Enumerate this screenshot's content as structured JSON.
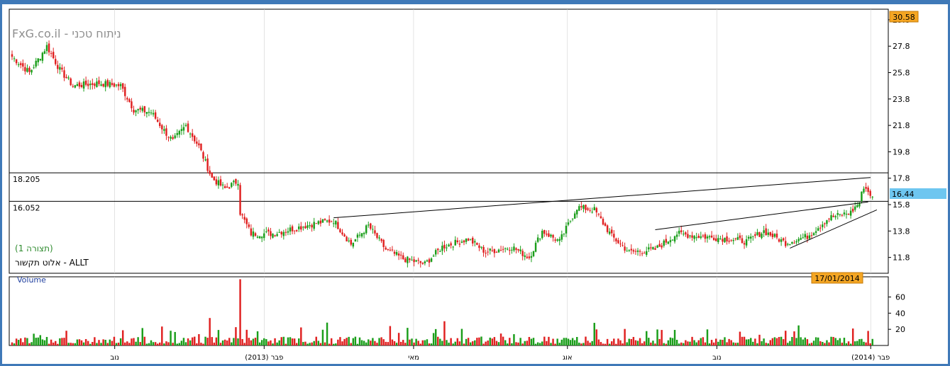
{
  "chart_data": {
    "type": "candlestick",
    "watermark": "FxG.co.il - ניתוח טכני",
    "symbol_label": "אלוט תקשור - ALLT",
    "study_label": "(תצורה 1)",
    "volume_label": "Volume",
    "date_badge": "17/01/2014",
    "price_axis": {
      "ticks": [
        11.8,
        13.8,
        15.8,
        17.8,
        19.8,
        21.8,
        23.8,
        25.8,
        27.8,
        29.8
      ],
      "ylim": [
        10.6,
        30.6
      ],
      "top_badge": "30.58"
    },
    "last_price": "16.44",
    "levels": [
      {
        "label": "18.205",
        "value": 18.205
      },
      {
        "label": "16.052",
        "value": 16.052
      }
    ],
    "volume_axis": {
      "ticks": [
        20,
        40,
        60
      ],
      "ylim": [
        0,
        85
      ]
    },
    "x_labels": [
      "נוב",
      "(2013) פבר",
      "מאי",
      "אוג",
      "נוב",
      "(2014) פבר"
    ],
    "anchors": [
      {
        "i": 0,
        "v": 27.0
      },
      {
        "i": 8,
        "v": 25.8
      },
      {
        "i": 16,
        "v": 27.8
      },
      {
        "i": 22,
        "v": 26.0
      },
      {
        "i": 28,
        "v": 24.8
      },
      {
        "i": 40,
        "v": 25.0
      },
      {
        "i": 50,
        "v": 24.8
      },
      {
        "i": 56,
        "v": 23.0
      },
      {
        "i": 64,
        "v": 22.8
      },
      {
        "i": 70,
        "v": 21.4
      },
      {
        "i": 74,
        "v": 20.6
      },
      {
        "i": 80,
        "v": 21.8
      },
      {
        "i": 86,
        "v": 20.2
      },
      {
        "i": 92,
        "v": 17.8
      },
      {
        "i": 98,
        "v": 17.0
      },
      {
        "i": 104,
        "v": 17.6
      },
      {
        "i": 105,
        "v": 15.2
      },
      {
        "i": 110,
        "v": 13.6
      },
      {
        "i": 120,
        "v": 13.6
      },
      {
        "i": 130,
        "v": 14.0
      },
      {
        "i": 140,
        "v": 14.4
      },
      {
        "i": 148,
        "v": 14.6
      },
      {
        "i": 156,
        "v": 12.8
      },
      {
        "i": 164,
        "v": 14.2
      },
      {
        "i": 172,
        "v": 12.4
      },
      {
        "i": 180,
        "v": 11.7
      },
      {
        "i": 190,
        "v": 11.3
      },
      {
        "i": 198,
        "v": 12.6
      },
      {
        "i": 210,
        "v": 13.2
      },
      {
        "i": 218,
        "v": 12.2
      },
      {
        "i": 230,
        "v": 12.6
      },
      {
        "i": 238,
        "v": 11.8
      },
      {
        "i": 244,
        "v": 13.8
      },
      {
        "i": 252,
        "v": 13.0
      },
      {
        "i": 260,
        "v": 15.6
      },
      {
        "i": 268,
        "v": 15.4
      },
      {
        "i": 276,
        "v": 13.4
      },
      {
        "i": 284,
        "v": 12.2
      },
      {
        "i": 296,
        "v": 12.4
      },
      {
        "i": 306,
        "v": 13.6
      },
      {
        "i": 316,
        "v": 13.4
      },
      {
        "i": 330,
        "v": 13.2
      },
      {
        "i": 338,
        "v": 13.0
      },
      {
        "i": 346,
        "v": 13.8
      },
      {
        "i": 356,
        "v": 12.9
      },
      {
        "i": 366,
        "v": 13.4
      },
      {
        "i": 376,
        "v": 14.8
      },
      {
        "i": 386,
        "v": 15.2
      },
      {
        "i": 390,
        "v": 16.0
      },
      {
        "i": 392,
        "v": 17.2
      },
      {
        "i": 396,
        "v": 16.4
      }
    ]
  }
}
